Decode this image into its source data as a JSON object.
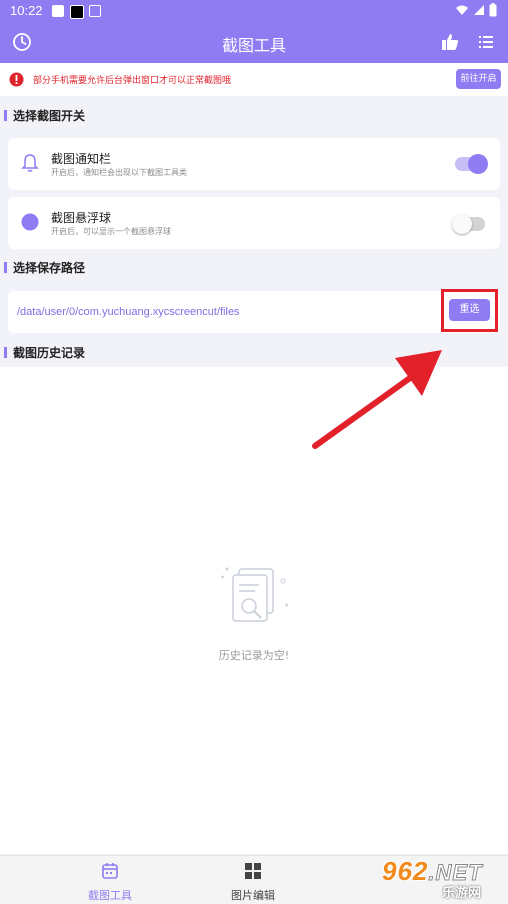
{
  "status_bar": {
    "time": "10:22"
  },
  "app_bar": {
    "title": "截图工具"
  },
  "notice": {
    "text": "部分手机需要允许后台弹出窗口才可以正常截图哦",
    "button_label": "前往开启"
  },
  "sections": {
    "switch_title": "选择截图开关",
    "path_title": "选择保存路径",
    "history_title": "截图历史记录"
  },
  "switches": [
    {
      "title": "截图通知栏",
      "subtitle": "开启后，通知栏会出现以下截图工具类",
      "on": true,
      "icon": "bell-icon"
    },
    {
      "title": "截图悬浮球",
      "subtitle": "开启后，可以显示一个截图悬浮球",
      "on": false,
      "icon": "floating-ball-icon"
    }
  ],
  "save_path": {
    "path": "/data/user/0/com.yuchuang.xycscreencut/files",
    "reselect_label": "重选"
  },
  "history": {
    "empty_text": "历史记录为空!"
  },
  "bottom_nav": [
    {
      "label": "截图工具",
      "icon": "calendar-icon",
      "active": true
    },
    {
      "label": "图片编辑",
      "icon": "grid-icon",
      "active": false
    }
  ],
  "watermark": {
    "brand": "962",
    "suffix": ".NET",
    "site": "乐游网"
  },
  "colors": {
    "accent": "#8f7bf2",
    "warning": "#e0242c",
    "annotation": "#e3212b"
  }
}
